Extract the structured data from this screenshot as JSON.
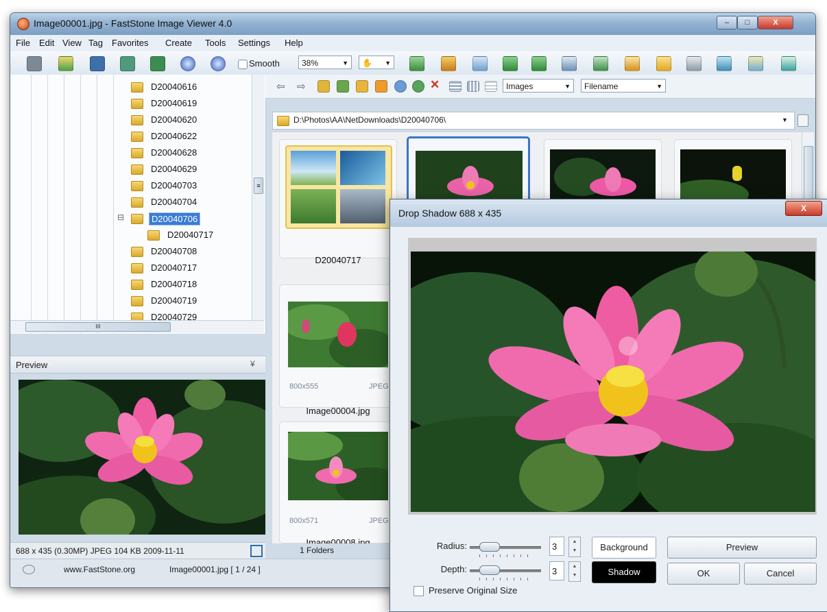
{
  "window": {
    "title": "Image00001.jpg - FastStone Image Viewer 4.0",
    "min_glyph": "–",
    "max_glyph": "□",
    "close_glyph": "X"
  },
  "menu": [
    "File",
    "Edit",
    "View",
    "Tag",
    "Favorites",
    "Create",
    "Tools",
    "Settings",
    "Help"
  ],
  "toolbar": {
    "smooth_label": "Smooth",
    "zoom_value": "38%",
    "icon_names": [
      "camera-icon",
      "open-folder-icon",
      "save-icon",
      "save-as-icon",
      "export-icon",
      "zoom-in-icon",
      "zoom-out-icon"
    ],
    "right_icon_names": [
      "copy-icon",
      "crop-icon",
      "resize-icon",
      "rotate-left-icon",
      "rotate-right-icon",
      "compare-icon",
      "levels-icon",
      "slideshow-icon",
      "batch-icon",
      "print-icon",
      "email-icon",
      "settings-icon",
      "fullscreen-icon"
    ]
  },
  "tree": {
    "items": [
      {
        "label": "D20040616",
        "level": 1
      },
      {
        "label": "D20040619",
        "level": 1
      },
      {
        "label": "D20040620",
        "level": 1
      },
      {
        "label": "D20040622",
        "level": 1
      },
      {
        "label": "D20040628",
        "level": 1
      },
      {
        "label": "D20040629",
        "level": 1
      },
      {
        "label": "D20040703",
        "level": 1
      },
      {
        "label": "D20040704",
        "level": 1
      },
      {
        "label": "D20040706",
        "level": 1,
        "selected": true,
        "expander": "⊟"
      },
      {
        "label": "D20040717",
        "level": 2
      },
      {
        "label": "D20040708",
        "level": 1
      },
      {
        "label": "D20040717",
        "level": 1
      },
      {
        "label": "D20040718",
        "level": 1
      },
      {
        "label": "D20040719",
        "level": 1
      },
      {
        "label": "D20040729",
        "level": 1
      }
    ],
    "hscroll_grip": "III",
    "vscroll_grip": "≡"
  },
  "preview": {
    "title": "Preview",
    "collapse_glyph": "¥",
    "info": "688 x 435 (0.30MP) JPEG   104 KB   2009-11-11"
  },
  "browser": {
    "filter_value": "Images",
    "sort_value": "Filename",
    "path": "D:\\Photos\\AA\\NetDownloads\\D20040706\\",
    "thumbs": [
      {
        "caption": "D20040717",
        "type": "folder"
      },
      {
        "caption": "Image00004.jpg",
        "size": "800x555",
        "format": "JPEG"
      },
      {
        "caption": "Image00008.jpg",
        "size": "800x571",
        "format": "JPEG"
      }
    ]
  },
  "status": {
    "folders": "1 Folders",
    "website": "www.FastStone.org",
    "file_position": "Image00001.jpg [ 1 / 24 ]"
  },
  "dialog": {
    "title": "Drop Shadow   688 x 435",
    "close_glyph": "X",
    "radius_label": "Radius:",
    "radius_value": "3",
    "depth_label": "Depth:",
    "depth_value": "3",
    "background_label": "Background",
    "shadow_label": "Shadow",
    "preview_label": "Preview",
    "ok_label": "OK",
    "cancel_label": "Cancel",
    "preserve_label": "Preserve Original Size",
    "preserve_checked": false,
    "spin_up": "▲",
    "spin_down": "▼"
  }
}
